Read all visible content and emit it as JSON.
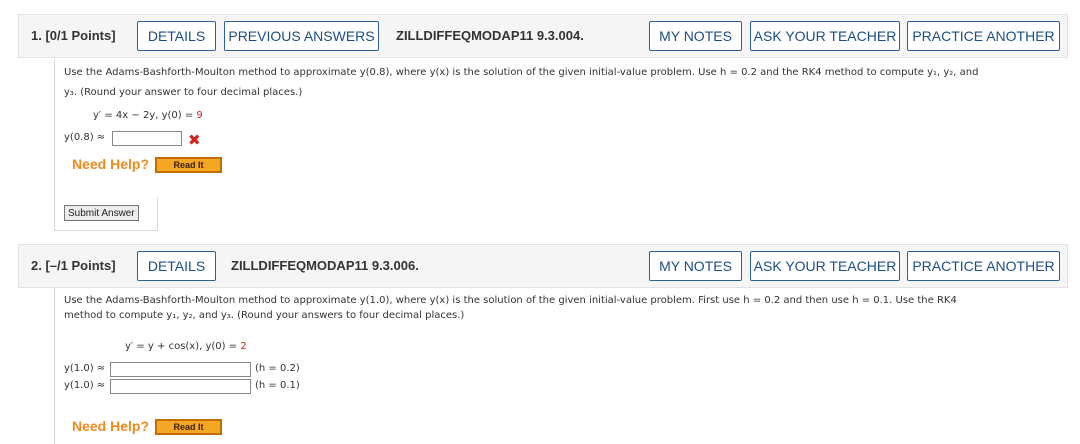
{
  "questions": [
    {
      "number": "1. [0/1 Points]",
      "buttons": {
        "details": "DETAILS",
        "previous_answers": "PREVIOUS ANSWERS",
        "my_notes": "MY NOTES",
        "ask_teacher": "ASK YOUR TEACHER",
        "practice_another": "PRACTICE ANOTHER"
      },
      "code": "ZILLDIFFEQMODAP11 9.3.004.",
      "prompt_line1": "Use the Adams-Bashforth-Moulton method to approximate y(0.8), where y(x) is the solution of the given initial-value problem. Use h = 0.2 and the RK4 method to compute y₁, y₂, and",
      "prompt_line2": "y₃. (Round your answer to four decimal places.)",
      "equation_prefix": "y′ = 4x − 2y,  y(0) = ",
      "equation_value": "9",
      "answer_label": "y(0.8) ≈",
      "answer_value": "",
      "answer_status": "incorrect",
      "help_label": "Need Help?",
      "read_it": "Read It",
      "submit": "Submit Answer"
    },
    {
      "number": "2. [–/1 Points]",
      "buttons": {
        "details": "DETAILS",
        "my_notes": "MY NOTES",
        "ask_teacher": "ASK YOUR TEACHER",
        "practice_another": "PRACTICE ANOTHER"
      },
      "code": "ZILLDIFFEQMODAP11 9.3.006.",
      "prompt_line1": "Use the Adams-Bashforth-Moulton method to approximate y(1.0), where y(x) is the solution of the given initial-value problem. First use h = 0.2 and then use h = 0.1. Use the RK4",
      "prompt_line2": "method to compute y₁, y₂, and y₃. (Round your answers to four decimal places.)",
      "equation_prefix": "y′ = y + cos(x),   y(0) = ",
      "equation_value": "2",
      "answers": [
        {
          "label": "y(1.0) ≈",
          "value": "",
          "note": "(h = 0.2)"
        },
        {
          "label": "y(1.0) ≈",
          "value": "",
          "note": "(h = 0.1)"
        }
      ],
      "help_label": "Need Help?",
      "read_it": "Read It"
    }
  ],
  "colors": {
    "button_border": "#2b5f95",
    "button_text": "#1b4e86",
    "help_orange": "#f08a1c",
    "error_red": "#d6201e",
    "value_red": "#c8291c"
  }
}
